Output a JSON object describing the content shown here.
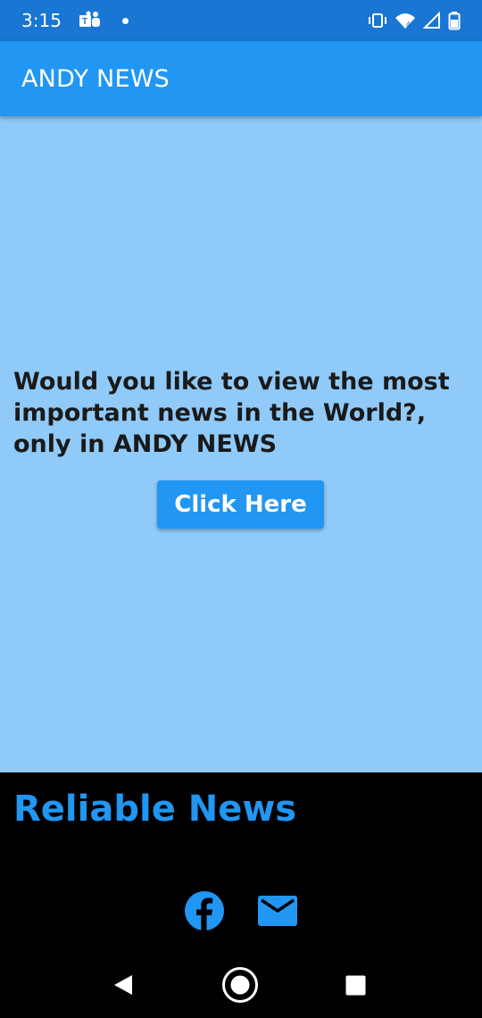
{
  "status_bar": {
    "time": "3:15"
  },
  "app_bar": {
    "title": "ANDY NEWS"
  },
  "main": {
    "prompt_text": "Would you like to view the most important news in the World?, only in ANDY NEWS",
    "button_label": "Click Here"
  },
  "footer": {
    "title": "Reliable News",
    "icons": [
      "facebook-icon",
      "mail-icon"
    ]
  },
  "colors": {
    "status_bar": "#1976D2",
    "app_bar": "#2196F3",
    "main_bg": "#90CAF9",
    "accent": "#2196F3",
    "footer_bg": "#000000"
  }
}
